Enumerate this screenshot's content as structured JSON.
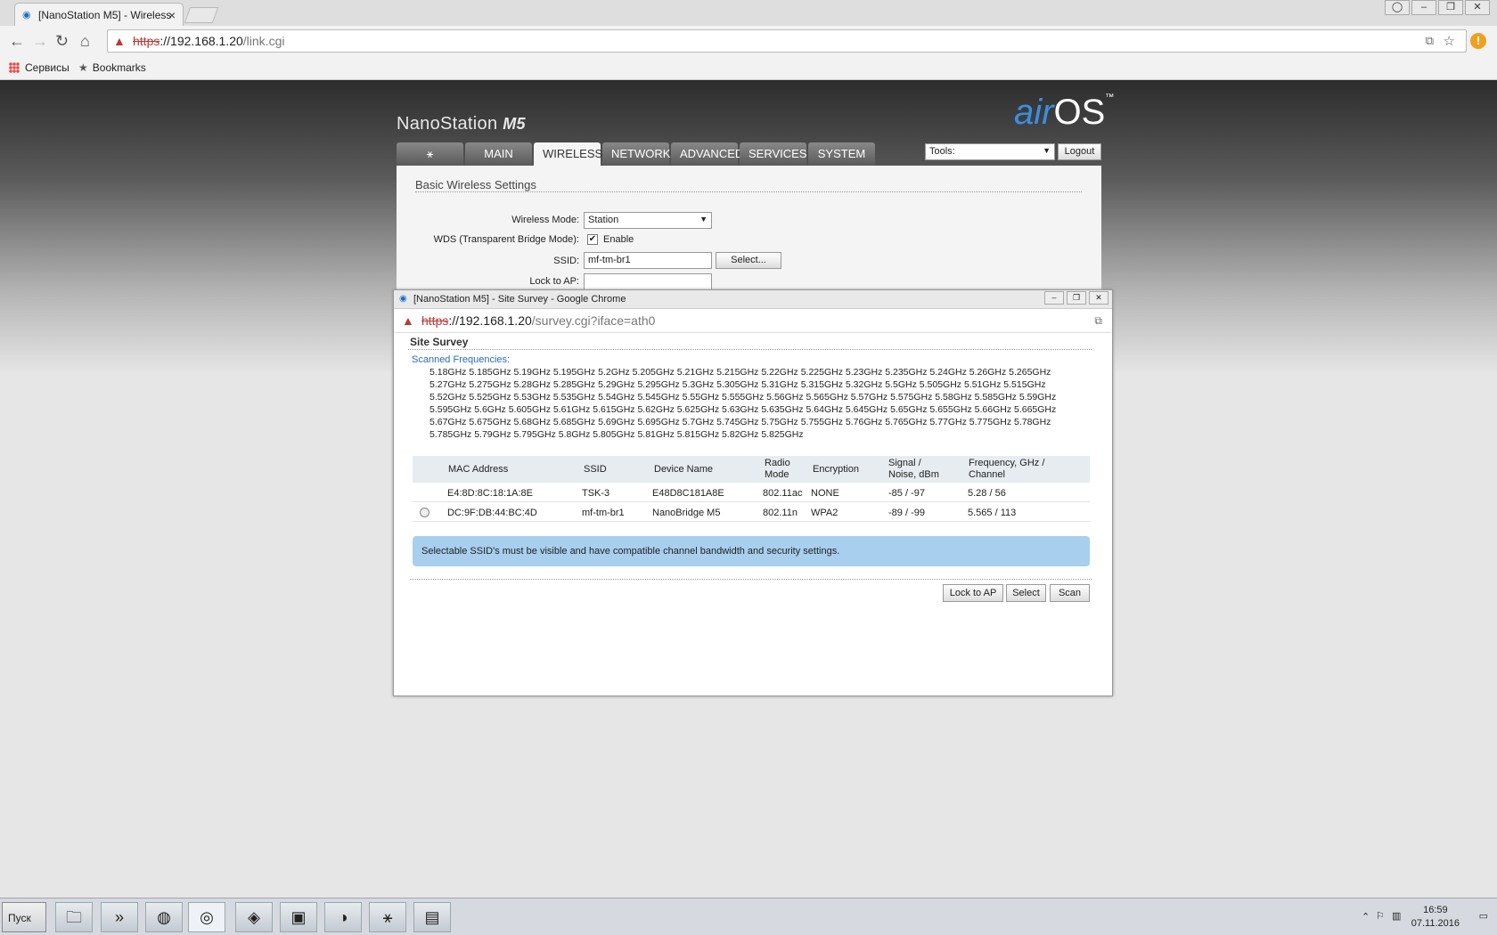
{
  "browser": {
    "tab_title": "[NanoStation M5] - Wireless",
    "url_scheme": "https",
    "url_host": "://192.168.1.20",
    "url_path": "/link.cgi",
    "bookmarks": [
      "Сервисы",
      "Bookmarks"
    ]
  },
  "header": {
    "brand": "NanoStation",
    "brand_model": "M5",
    "logo_air": "air",
    "logo_os": "OS",
    "logo_tm": "™"
  },
  "nav": {
    "tabs": [
      "MAIN",
      "WIRELESS",
      "NETWORK",
      "ADVANCED",
      "SERVICES",
      "SYSTEM"
    ],
    "active": "WIRELESS",
    "tools_label": "Tools:",
    "logout": "Logout"
  },
  "form": {
    "section_title": "Basic Wireless Settings",
    "wireless_mode_label": "Wireless Mode:",
    "wireless_mode_value": "Station",
    "wds_label": "WDS (Transparent Bridge Mode):",
    "wds_enable": "Enable",
    "ssid_label": "SSID:",
    "ssid_value": "mf-tm-br1",
    "select_btn": "Select...",
    "lock_label": "Lock to AP:",
    "lock_value": ""
  },
  "popup": {
    "title": "[NanoStation M5] - Site Survey - Google Chrome",
    "url_scheme": "https",
    "url_host": "://192.168.1.20",
    "url_path": "/survey.cgi?iface=ath0",
    "heading": "Site Survey",
    "scanned_label": "Scanned Frequencies:",
    "freq_lines": [
      "5.18GHz 5.185GHz 5.19GHz 5.195GHz 5.2GHz 5.205GHz 5.21GHz 5.215GHz 5.22GHz 5.225GHz 5.23GHz 5.235GHz 5.24GHz 5.26GHz 5.265GHz",
      "5.27GHz 5.275GHz 5.28GHz 5.285GHz 5.29GHz 5.295GHz 5.3GHz 5.305GHz 5.31GHz 5.315GHz 5.32GHz 5.5GHz 5.505GHz 5.51GHz 5.515GHz",
      "5.52GHz 5.525GHz 5.53GHz 5.535GHz 5.54GHz 5.545GHz 5.55GHz 5.555GHz 5.56GHz 5.565GHz 5.57GHz 5.575GHz 5.58GHz 5.585GHz 5.59GHz",
      "5.595GHz 5.6GHz 5.605GHz 5.61GHz 5.615GHz 5.62GHz 5.625GHz 5.63GHz 5.635GHz 5.64GHz 5.645GHz 5.65GHz 5.655GHz 5.66GHz 5.665GHz",
      "5.67GHz 5.675GHz 5.68GHz 5.685GHz 5.69GHz 5.695GHz 5.7GHz 5.745GHz 5.75GHz 5.755GHz 5.76GHz 5.765GHz 5.77GHz 5.775GHz 5.78GHz",
      "5.785GHz 5.79GHz 5.795GHz 5.8GHz 5.805GHz 5.81GHz 5.815GHz 5.82GHz 5.825GHz"
    ],
    "columns": {
      "mac": "MAC Address",
      "ssid": "SSID",
      "device": "Device Name",
      "radio1": "Radio",
      "radio2": "Mode",
      "enc": "Encryption",
      "sig1": "Signal /",
      "sig2": "Noise, dBm",
      "freq1": "Frequency, GHz /",
      "freq2": "Channel"
    },
    "rows": [
      {
        "mac": "E4:8D:8C:18:1A:8E",
        "ssid": "TSK-3",
        "device": "E48D8C181A8E",
        "mode": "802.11ac",
        "enc": "NONE",
        "signal": "-85 / -97",
        "freq": "5.28 / 56"
      },
      {
        "mac": "DC:9F:DB:44:BC:4D",
        "ssid": "mf-tm-br1",
        "device": "NanoBridge M5",
        "mode": "802.11n",
        "enc": "WPA2",
        "signal": "-89 / -99",
        "freq": "5.565 / 113"
      }
    ],
    "info": "Selectable SSID's must be visible and have compatible channel bandwidth and security settings.",
    "buttons": {
      "lock": "Lock to AP",
      "select": "Select",
      "scan": "Scan"
    }
  },
  "taskbar": {
    "start": "Пуск",
    "time": "16:59",
    "date": "07.11.2016"
  }
}
